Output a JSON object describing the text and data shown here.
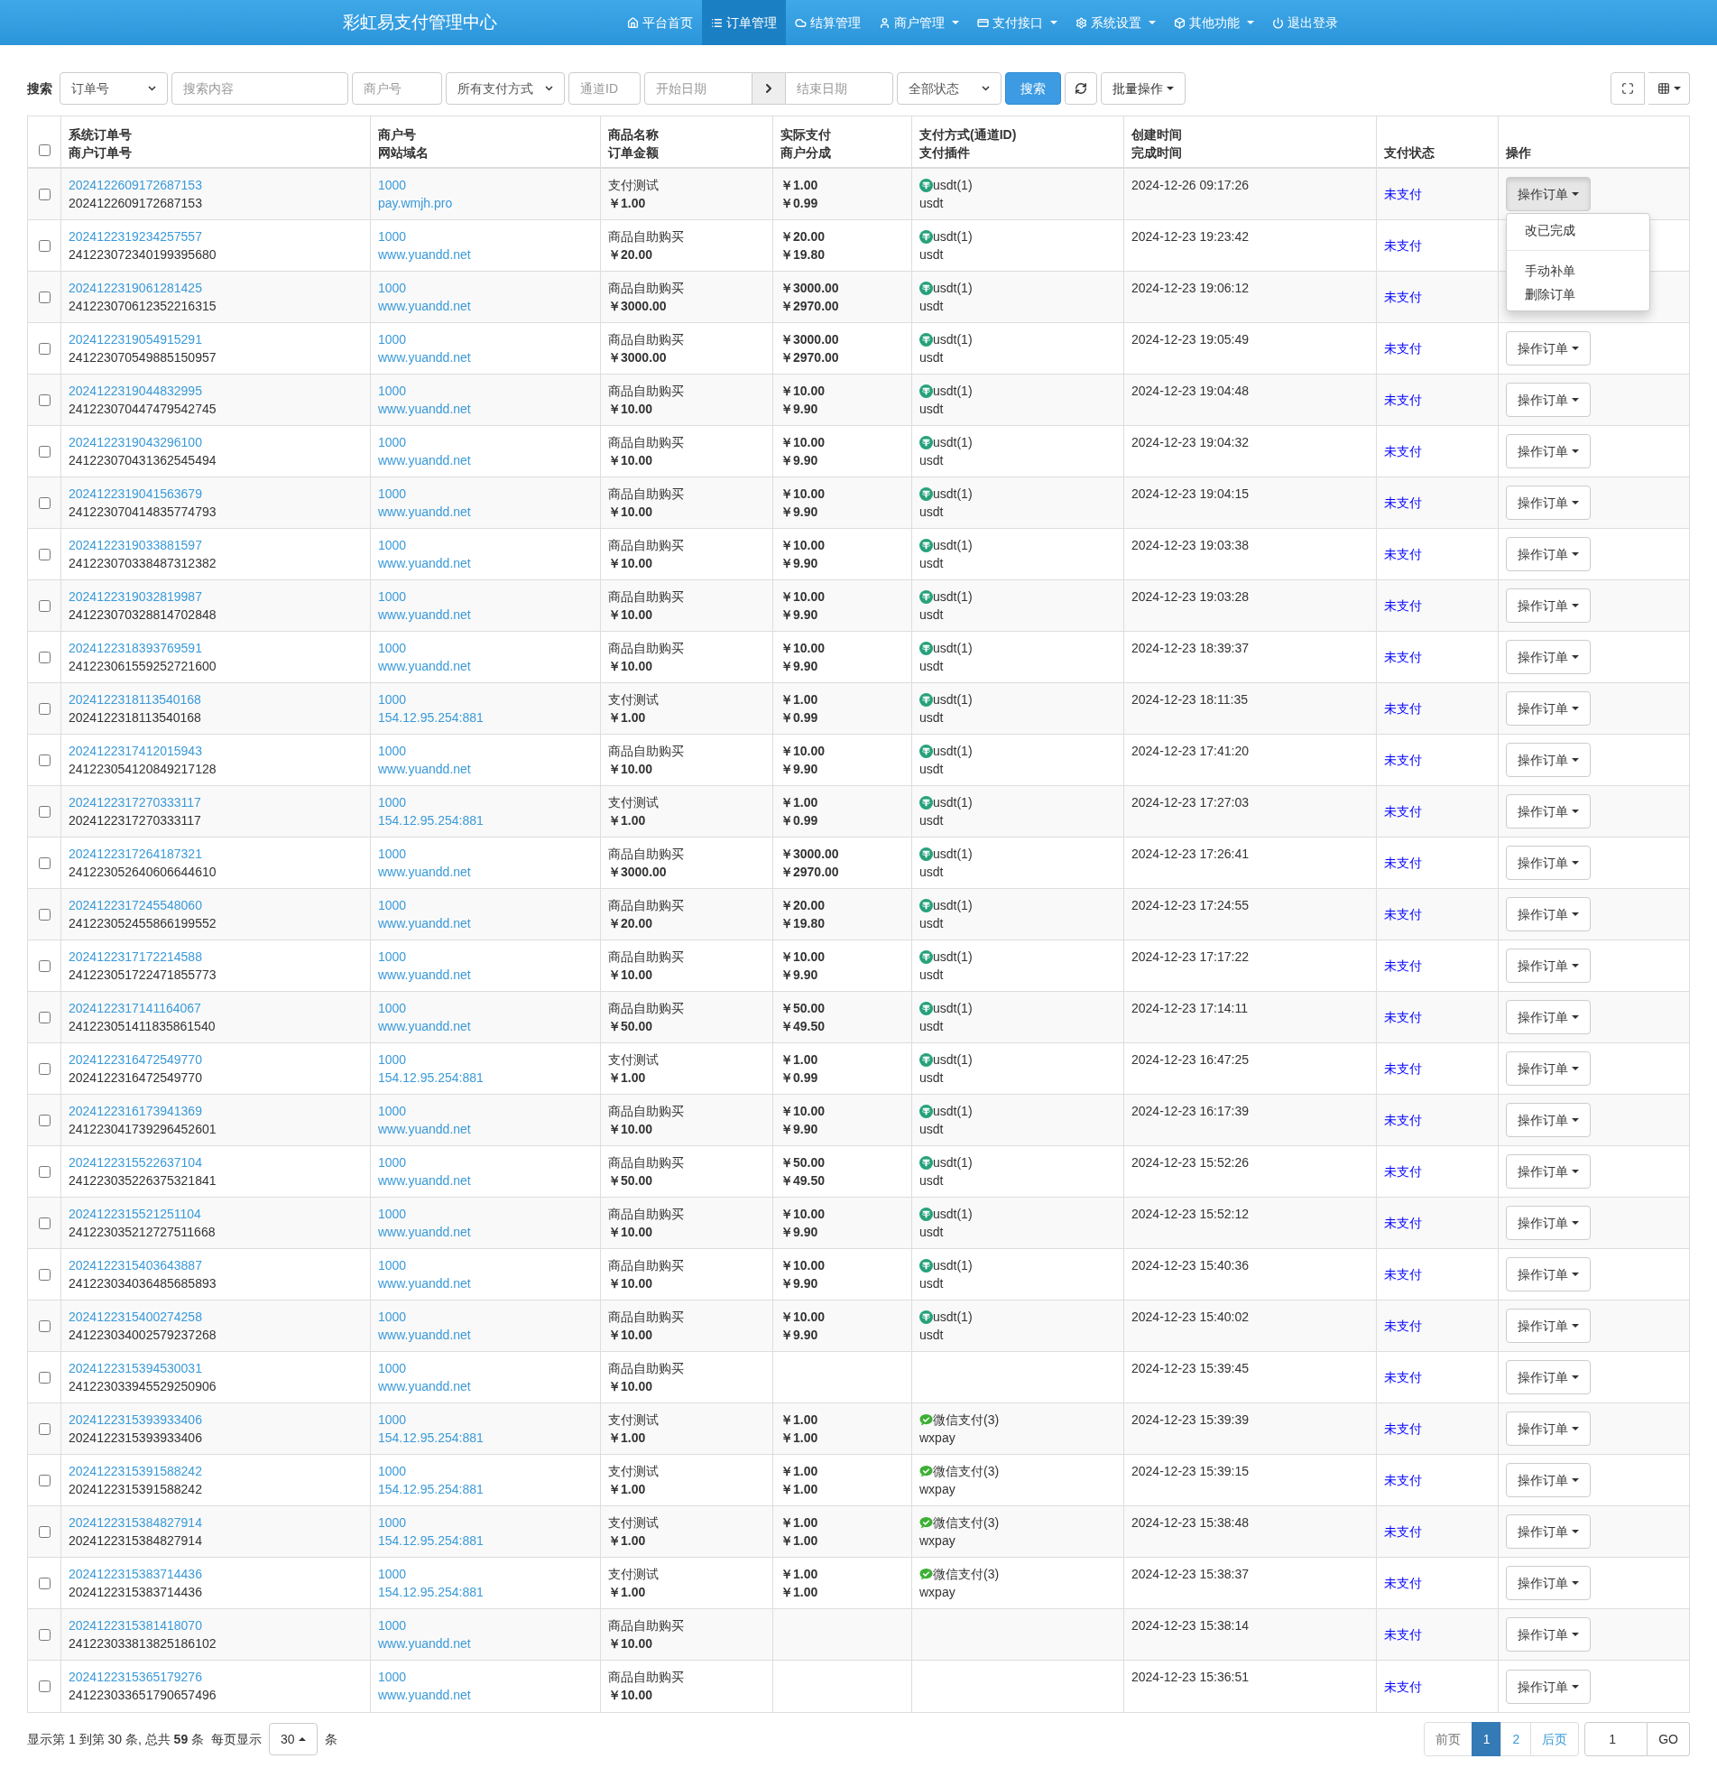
{
  "header": {
    "title": "彩虹易支付管理中心",
    "nav": [
      {
        "label": "平台首页",
        "selected": false,
        "has_menu": false
      },
      {
        "label": "订单管理",
        "selected": true,
        "has_menu": false
      },
      {
        "label": "结算管理",
        "selected": false,
        "has_menu": false
      },
      {
        "label": "商户管理",
        "selected": false,
        "has_menu": true
      },
      {
        "label": "支付接口",
        "selected": false,
        "has_menu": true
      },
      {
        "label": "系统设置",
        "selected": false,
        "has_menu": true
      },
      {
        "label": "其他功能",
        "selected": false,
        "has_menu": true
      },
      {
        "label": "退出登录",
        "selected": false,
        "has_menu": false
      }
    ]
  },
  "filters": {
    "label": "搜索",
    "search_type": "订单号",
    "search_placeholder": "搜索内容",
    "merchant_placeholder": "商户号",
    "pay_type": "所有支付方式",
    "channel_placeholder": "通道ID",
    "start_date_placeholder": "开始日期",
    "end_date_placeholder": "结束日期",
    "status": "全部状态",
    "search_button": "搜索",
    "batch_button": "批量操作"
  },
  "table": {
    "select_all": {
      "checked": false
    },
    "columns": [
      [
        "系统订单号",
        "商户订单号"
      ],
      [
        "商户号",
        "网站域名"
      ],
      [
        "商品名称",
        "订单金额"
      ],
      [
        "实际支付",
        "商户分成"
      ],
      [
        "支付方式(通道ID)",
        "支付插件"
      ],
      [
        "创建时间",
        "完成时间"
      ],
      [
        "支付状态"
      ],
      [
        "操作"
      ]
    ],
    "action_menu": [
      "改已完成",
      "手动补单",
      "删除订单"
    ],
    "rows": [
      {
        "checked": false,
        "menu_open": true,
        "trade_no": "2024122609172687153",
        "out_trade_no": "2024122609172687153",
        "uid": "1000",
        "site": "pay.wmjh.pro",
        "name": "支付测试",
        "money": "￥1.00",
        "real": "￥1.00",
        "share": "￥0.99",
        "kind": "usdt",
        "pay_type": "usdt(1)",
        "plugin": "usdt",
        "time": "2024-12-26 09:17:26",
        "status": "未支付",
        "action": "操作订单"
      },
      {
        "checked": false,
        "trade_no": "2024122319234257557",
        "out_trade_no": "241223072340199395680",
        "uid": "1000",
        "site": "www.yuandd.net",
        "name": "商品自助购买",
        "money": "￥20.00",
        "real": "￥20.00",
        "share": "￥19.80",
        "kind": "usdt",
        "pay_type": "usdt(1)",
        "plugin": "usdt",
        "time": "2024-12-23 19:23:42",
        "status": "未支付"
      },
      {
        "checked": false,
        "trade_no": "2024122319061281425",
        "out_trade_no": "241223070612352216315",
        "uid": "1000",
        "site": "www.yuandd.net",
        "name": "商品自助购买",
        "money": "￥3000.00",
        "real": "￥3000.00",
        "share": "￥2970.00",
        "kind": "usdt",
        "pay_type": "usdt(1)",
        "plugin": "usdt",
        "time": "2024-12-23 19:06:12",
        "status": "未支付"
      },
      {
        "checked": false,
        "menu_open": false,
        "trade_no": "2024122319054915291",
        "out_trade_no": "241223070549885150957",
        "uid": "1000",
        "site": "www.yuandd.net",
        "name": "商品自助购买",
        "money": "￥3000.00",
        "real": "￥3000.00",
        "share": "￥2970.00",
        "kind": "usdt",
        "pay_type": "usdt(1)",
        "plugin": "usdt",
        "time": "2024-12-23 19:05:49",
        "status": "未支付",
        "action": "操作订单"
      },
      {
        "checked": false,
        "menu_open": false,
        "trade_no": "2024122319044832995",
        "out_trade_no": "241223070447479542745",
        "uid": "1000",
        "site": "www.yuandd.net",
        "name": "商品自助购买",
        "money": "￥10.00",
        "real": "￥10.00",
        "share": "￥9.90",
        "kind": "usdt",
        "pay_type": "usdt(1)",
        "plugin": "usdt",
        "time": "2024-12-23 19:04:48",
        "status": "未支付",
        "action": "操作订单"
      },
      {
        "checked": false,
        "menu_open": false,
        "trade_no": "2024122319043296100",
        "out_trade_no": "241223070431362545494",
        "uid": "1000",
        "site": "www.yuandd.net",
        "name": "商品自助购买",
        "money": "￥10.00",
        "real": "￥10.00",
        "share": "￥9.90",
        "kind": "usdt",
        "pay_type": "usdt(1)",
        "plugin": "usdt",
        "time": "2024-12-23 19:04:32",
        "status": "未支付",
        "action": "操作订单"
      },
      {
        "checked": false,
        "menu_open": false,
        "trade_no": "2024122319041563679",
        "out_trade_no": "241223070414835774793",
        "uid": "1000",
        "site": "www.yuandd.net",
        "name": "商品自助购买",
        "money": "￥10.00",
        "real": "￥10.00",
        "share": "￥9.90",
        "kind": "usdt",
        "pay_type": "usdt(1)",
        "plugin": "usdt",
        "time": "2024-12-23 19:04:15",
        "status": "未支付",
        "action": "操作订单"
      },
      {
        "checked": false,
        "menu_open": false,
        "trade_no": "2024122319033881597",
        "out_trade_no": "241223070338487312382",
        "uid": "1000",
        "site": "www.yuandd.net",
        "name": "商品自助购买",
        "money": "￥10.00",
        "real": "￥10.00",
        "share": "￥9.90",
        "kind": "usdt",
        "pay_type": "usdt(1)",
        "plugin": "usdt",
        "time": "2024-12-23 19:03:38",
        "status": "未支付",
        "action": "操作订单"
      },
      {
        "checked": false,
        "menu_open": false,
        "trade_no": "2024122319032819987",
        "out_trade_no": "241223070328814702848",
        "uid": "1000",
        "site": "www.yuandd.net",
        "name": "商品自助购买",
        "money": "￥10.00",
        "real": "￥10.00",
        "share": "￥9.90",
        "kind": "usdt",
        "pay_type": "usdt(1)",
        "plugin": "usdt",
        "time": "2024-12-23 19:03:28",
        "status": "未支付",
        "action": "操作订单"
      },
      {
        "checked": false,
        "menu_open": false,
        "trade_no": "2024122318393769591",
        "out_trade_no": "241223061559252721600",
        "uid": "1000",
        "site": "www.yuandd.net",
        "name": "商品自助购买",
        "money": "￥10.00",
        "real": "￥10.00",
        "share": "￥9.90",
        "kind": "usdt",
        "pay_type": "usdt(1)",
        "plugin": "usdt",
        "time": "2024-12-23 18:39:37",
        "status": "未支付",
        "action": "操作订单"
      },
      {
        "checked": false,
        "menu_open": false,
        "trade_no": "2024122318113540168",
        "out_trade_no": "2024122318113540168",
        "uid": "1000",
        "site": "154.12.95.254:881",
        "name": "支付测试",
        "money": "￥1.00",
        "real": "￥1.00",
        "share": "￥0.99",
        "kind": "usdt",
        "pay_type": "usdt(1)",
        "plugin": "usdt",
        "time": "2024-12-23 18:11:35",
        "status": "未支付",
        "action": "操作订单"
      },
      {
        "checked": false,
        "menu_open": false,
        "trade_no": "2024122317412015943",
        "out_trade_no": "241223054120849217128",
        "uid": "1000",
        "site": "www.yuandd.net",
        "name": "商品自助购买",
        "money": "￥10.00",
        "real": "￥10.00",
        "share": "￥9.90",
        "kind": "usdt",
        "pay_type": "usdt(1)",
        "plugin": "usdt",
        "time": "2024-12-23 17:41:20",
        "status": "未支付",
        "action": "操作订单"
      },
      {
        "checked": false,
        "menu_open": false,
        "trade_no": "2024122317270333117",
        "out_trade_no": "2024122317270333117",
        "uid": "1000",
        "site": "154.12.95.254:881",
        "name": "支付测试",
        "money": "￥1.00",
        "real": "￥1.00",
        "share": "￥0.99",
        "kind": "usdt",
        "pay_type": "usdt(1)",
        "plugin": "usdt",
        "time": "2024-12-23 17:27:03",
        "status": "未支付",
        "action": "操作订单"
      },
      {
        "checked": false,
        "menu_open": false,
        "trade_no": "2024122317264187321",
        "out_trade_no": "241223052640606644610",
        "uid": "1000",
        "site": "www.yuandd.net",
        "name": "商品自助购买",
        "money": "￥3000.00",
        "real": "￥3000.00",
        "share": "￥2970.00",
        "kind": "usdt",
        "pay_type": "usdt(1)",
        "plugin": "usdt",
        "time": "2024-12-23 17:26:41",
        "status": "未支付",
        "action": "操作订单"
      },
      {
        "checked": false,
        "menu_open": false,
        "trade_no": "2024122317245548060",
        "out_trade_no": "241223052455866199552",
        "uid": "1000",
        "site": "www.yuandd.net",
        "name": "商品自助购买",
        "money": "￥20.00",
        "real": "￥20.00",
        "share": "￥19.80",
        "kind": "usdt",
        "pay_type": "usdt(1)",
        "plugin": "usdt",
        "time": "2024-12-23 17:24:55",
        "status": "未支付",
        "action": "操作订单"
      },
      {
        "checked": false,
        "menu_open": false,
        "trade_no": "2024122317172214588",
        "out_trade_no": "241223051722471855773",
        "uid": "1000",
        "site": "www.yuandd.net",
        "name": "商品自助购买",
        "money": "￥10.00",
        "real": "￥10.00",
        "share": "￥9.90",
        "kind": "usdt",
        "pay_type": "usdt(1)",
        "plugin": "usdt",
        "time": "2024-12-23 17:17:22",
        "status": "未支付",
        "action": "操作订单"
      },
      {
        "checked": false,
        "menu_open": false,
        "trade_no": "2024122317141164067",
        "out_trade_no": "241223051411835861540",
        "uid": "1000",
        "site": "www.yuandd.net",
        "name": "商品自助购买",
        "money": "￥50.00",
        "real": "￥50.00",
        "share": "￥49.50",
        "kind": "usdt",
        "pay_type": "usdt(1)",
        "plugin": "usdt",
        "time": "2024-12-23 17:14:11",
        "status": "未支付",
        "action": "操作订单"
      },
      {
        "checked": false,
        "menu_open": false,
        "trade_no": "2024122316472549770",
        "out_trade_no": "2024122316472549770",
        "uid": "1000",
        "site": "154.12.95.254:881",
        "name": "支付测试",
        "money": "￥1.00",
        "real": "￥1.00",
        "share": "￥0.99",
        "kind": "usdt",
        "pay_type": "usdt(1)",
        "plugin": "usdt",
        "time": "2024-12-23 16:47:25",
        "status": "未支付",
        "action": "操作订单"
      },
      {
        "checked": false,
        "menu_open": false,
        "trade_no": "2024122316173941369",
        "out_trade_no": "241223041739296452601",
        "uid": "1000",
        "site": "www.yuandd.net",
        "name": "商品自助购买",
        "money": "￥10.00",
        "real": "￥10.00",
        "share": "￥9.90",
        "kind": "usdt",
        "pay_type": "usdt(1)",
        "plugin": "usdt",
        "time": "2024-12-23 16:17:39",
        "status": "未支付",
        "action": "操作订单"
      },
      {
        "checked": false,
        "menu_open": false,
        "trade_no": "2024122315522637104",
        "out_trade_no": "241223035226375321841",
        "uid": "1000",
        "site": "www.yuandd.net",
        "name": "商品自助购买",
        "money": "￥50.00",
        "real": "￥50.00",
        "share": "￥49.50",
        "kind": "usdt",
        "pay_type": "usdt(1)",
        "plugin": "usdt",
        "time": "2024-12-23 15:52:26",
        "status": "未支付",
        "action": "操作订单"
      },
      {
        "checked": false,
        "menu_open": false,
        "trade_no": "2024122315521251104",
        "out_trade_no": "241223035212727511668",
        "uid": "1000",
        "site": "www.yuandd.net",
        "name": "商品自助购买",
        "money": "￥10.00",
        "real": "￥10.00",
        "share": "￥9.90",
        "kind": "usdt",
        "pay_type": "usdt(1)",
        "plugin": "usdt",
        "time": "2024-12-23 15:52:12",
        "status": "未支付",
        "action": "操作订单"
      },
      {
        "checked": false,
        "menu_open": false,
        "trade_no": "2024122315403643887",
        "out_trade_no": "241223034036485685893",
        "uid": "1000",
        "site": "www.yuandd.net",
        "name": "商品自助购买",
        "money": "￥10.00",
        "real": "￥10.00",
        "share": "￥9.90",
        "kind": "usdt",
        "pay_type": "usdt(1)",
        "plugin": "usdt",
        "time": "2024-12-23 15:40:36",
        "status": "未支付",
        "action": "操作订单"
      },
      {
        "checked": false,
        "menu_open": false,
        "trade_no": "2024122315400274258",
        "out_trade_no": "241223034002579237268",
        "uid": "1000",
        "site": "www.yuandd.net",
        "name": "商品自助购买",
        "money": "￥10.00",
        "real": "￥10.00",
        "share": "￥9.90",
        "kind": "usdt",
        "pay_type": "usdt(1)",
        "plugin": "usdt",
        "time": "2024-12-23 15:40:02",
        "status": "未支付",
        "action": "操作订单"
      },
      {
        "checked": false,
        "menu_open": false,
        "trade_no": "2024122315394530031",
        "out_trade_no": "241223033945529250906",
        "uid": "1000",
        "site": "www.yuandd.net",
        "name": "商品自助购买",
        "money": "￥10.00",
        "time": "2024-12-23 15:39:45",
        "status": "未支付",
        "action": "操作订单"
      },
      {
        "checked": false,
        "menu_open": false,
        "trade_no": "2024122315393933406",
        "out_trade_no": "2024122315393933406",
        "uid": "1000",
        "site": "154.12.95.254:881",
        "name": "支付测试",
        "money": "￥1.00",
        "real": "￥1.00",
        "share": "￥1.00",
        "kind": "wxpay",
        "pay_type": "微信支付(3)",
        "plugin": "wxpay",
        "time": "2024-12-23 15:39:39",
        "status": "未支付",
        "action": "操作订单"
      },
      {
        "checked": false,
        "menu_open": false,
        "trade_no": "2024122315391588242",
        "out_trade_no": "2024122315391588242",
        "uid": "1000",
        "site": "154.12.95.254:881",
        "name": "支付测试",
        "money": "￥1.00",
        "real": "￥1.00",
        "share": "￥1.00",
        "kind": "wxpay",
        "pay_type": "微信支付(3)",
        "plugin": "wxpay",
        "time": "2024-12-23 15:39:15",
        "status": "未支付",
        "action": "操作订单"
      },
      {
        "checked": false,
        "menu_open": false,
        "trade_no": "2024122315384827914",
        "out_trade_no": "2024122315384827914",
        "uid": "1000",
        "site": "154.12.95.254:881",
        "name": "支付测试",
        "money": "￥1.00",
        "real": "￥1.00",
        "share": "￥1.00",
        "kind": "wxpay",
        "pay_type": "微信支付(3)",
        "plugin": "wxpay",
        "time": "2024-12-23 15:38:48",
        "status": "未支付",
        "action": "操作订单"
      },
      {
        "checked": false,
        "menu_open": false,
        "trade_no": "2024122315383714436",
        "out_trade_no": "2024122315383714436",
        "uid": "1000",
        "site": "154.12.95.254:881",
        "name": "支付测试",
        "money": "￥1.00",
        "real": "￥1.00",
        "share": "￥1.00",
        "kind": "wxpay",
        "pay_type": "微信支付(3)",
        "plugin": "wxpay",
        "time": "2024-12-23 15:38:37",
        "status": "未支付",
        "action": "操作订单"
      },
      {
        "checked": false,
        "menu_open": false,
        "trade_no": "2024122315381418070",
        "out_trade_no": "241223033813825186102",
        "uid": "1000",
        "site": "www.yuandd.net",
        "name": "商品自助购买",
        "money": "￥10.00",
        "time": "2024-12-23 15:38:14",
        "status": "未支付",
        "action": "操作订单"
      },
      {
        "checked": false,
        "menu_open": false,
        "trade_no": "2024122315365179276",
        "out_trade_no": "241223033651790657496",
        "uid": "1000",
        "site": "www.yuandd.net",
        "name": "商品自助购买",
        "money": "￥10.00",
        "time": "2024-12-23 15:36:51",
        "status": "未支付",
        "action": "操作订单"
      }
    ]
  },
  "footer": {
    "summary": "显示第 1 到第 30 条, 总共 **59** 条",
    "per_page_label": "每页显示",
    "per_page": "30",
    "unit": "条",
    "pages": [
      {
        "label": "前页",
        "selected": false,
        "disabled": true
      },
      {
        "label": "1",
        "selected": true,
        "disabled": false
      },
      {
        "label": "2",
        "selected": false,
        "disabled": false
      },
      {
        "label": "后页",
        "selected": false,
        "disabled": false
      }
    ],
    "jump_value": "1",
    "go_button": "GO"
  }
}
